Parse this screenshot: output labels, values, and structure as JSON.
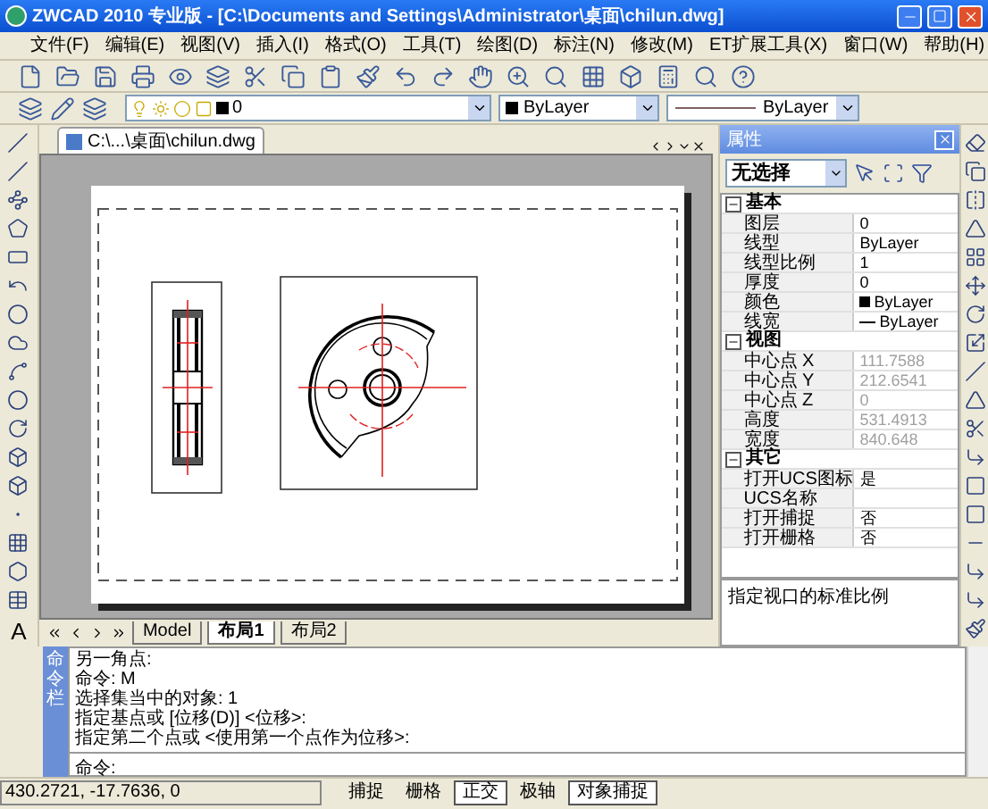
{
  "window": {
    "title": "ZWCAD 2010 专业版 - [C:\\Documents and Settings\\Administrator\\桌面\\chilun.dwg]"
  },
  "menu": [
    "文件(F)",
    "编辑(E)",
    "视图(V)",
    "插入(I)",
    "格式(O)",
    "工具(T)",
    "绘图(D)",
    "标注(N)",
    "修改(M)",
    "ET扩展工具(X)",
    "窗口(W)",
    "帮助(H)"
  ],
  "layer_toolbar": {
    "layer": "0",
    "color_setting": "ByLayer",
    "linetype": "ByLayer"
  },
  "document_tab": {
    "title": "C:\\...\\桌面\\chilun.dwg"
  },
  "left_toolbar": {
    "text_tool": "A"
  },
  "layout_tabs": [
    {
      "label": "Model",
      "selected": false
    },
    {
      "label": "布局1",
      "selected": true
    },
    {
      "label": "布局2",
      "selected": false
    }
  ],
  "properties": {
    "title": "属性",
    "selection": "无选择",
    "groups": [
      {
        "name": "基本",
        "expanded": true,
        "rows": [
          {
            "label": "图层",
            "value": "0",
            "kind": "text",
            "disabled": false
          },
          {
            "label": "线型",
            "value": "ByLayer",
            "kind": "text",
            "disabled": false
          },
          {
            "label": "线型比例",
            "value": "1",
            "kind": "text",
            "disabled": false
          },
          {
            "label": "厚度",
            "value": "0",
            "kind": "text",
            "disabled": false
          },
          {
            "label": "颜色",
            "value": "ByLayer",
            "kind": "color",
            "disabled": false
          },
          {
            "label": "线宽",
            "value": "ByLayer",
            "kind": "lineweight",
            "disabled": false
          }
        ]
      },
      {
        "name": "视图",
        "expanded": true,
        "rows": [
          {
            "label": "中心点 X",
            "value": "111.7588",
            "kind": "text",
            "disabled": true
          },
          {
            "label": "中心点 Y",
            "value": "212.6541",
            "kind": "text",
            "disabled": true
          },
          {
            "label": "中心点 Z",
            "value": "0",
            "kind": "text",
            "disabled": true
          },
          {
            "label": "高度",
            "value": "531.4913",
            "kind": "text",
            "disabled": true
          },
          {
            "label": "宽度",
            "value": "840.648",
            "kind": "text",
            "disabled": true
          }
        ]
      },
      {
        "name": "其它",
        "expanded": true,
        "rows": [
          {
            "label": "打开UCS图标",
            "value": "是",
            "kind": "text",
            "disabled": false
          },
          {
            "label": "UCS名称",
            "value": "",
            "kind": "text",
            "disabled": false
          },
          {
            "label": "打开捕捉",
            "value": "否",
            "kind": "text",
            "disabled": false
          },
          {
            "label": "打开栅格",
            "value": "否",
            "kind": "text",
            "disabled": false
          }
        ]
      }
    ],
    "help": "指定视口的标准比例"
  },
  "command": {
    "label": "命令栏",
    "history": [
      "另一角点:",
      "命令: M",
      "选择集当中的对象: 1",
      "指定基点或 [位移(D)] <位移>:",
      "指定第二个点或 <使用第一个点作为位移>:"
    ],
    "prompt": "命令:"
  },
  "status_bar": {
    "coordinates": "430.2721, -17.7636, 0",
    "toggles": [
      {
        "label": "捕捉",
        "on": false
      },
      {
        "label": "栅格",
        "on": false
      },
      {
        "label": "正交",
        "on": true
      },
      {
        "label": "极轴",
        "on": false
      },
      {
        "label": "对象捕捉",
        "on": true
      }
    ]
  }
}
